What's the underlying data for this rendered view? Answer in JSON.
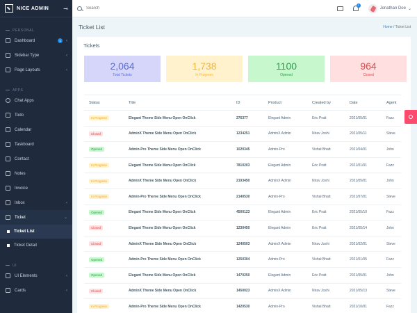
{
  "brand": {
    "name": "NICE ADMIN"
  },
  "sidebar": {
    "section_personal": "PERSONAL",
    "section_apps": "APPS",
    "section_ui": "UI",
    "items": [
      {
        "label": "Dashboard",
        "icon": "home-icon",
        "badge": "1"
      },
      {
        "label": "Sidebar Type",
        "icon": "sidebar-icon"
      },
      {
        "label": "Page Layouts",
        "icon": "layout-icon"
      },
      {
        "label": "Chat Apps",
        "icon": "chat-icon"
      },
      {
        "label": "Todo",
        "icon": "todo-icon"
      },
      {
        "label": "Calendar",
        "icon": "calendar-icon"
      },
      {
        "label": "Taskboard",
        "icon": "taskboard-icon"
      },
      {
        "label": "Contact",
        "icon": "contact-icon"
      },
      {
        "label": "Notes",
        "icon": "notes-icon"
      },
      {
        "label": "Invoice",
        "icon": "invoice-icon"
      },
      {
        "label": "Inbox",
        "icon": "inbox-icon"
      },
      {
        "label": "Ticket",
        "icon": "ticket-icon"
      },
      {
        "label": "Ticket List"
      },
      {
        "label": "Ticket Detail"
      },
      {
        "label": "UI Elements",
        "icon": "ui-icon"
      },
      {
        "label": "Cards",
        "icon": "cards-icon"
      }
    ]
  },
  "topbar": {
    "search_placeholder": "Search",
    "bell_badge": "1",
    "user_name": "Jonathan Doe"
  },
  "page": {
    "title": "Ticket List",
    "breadcrumb_home": "Home",
    "breadcrumb_sep": " / ",
    "breadcrumb_current": "Ticket List"
  },
  "card": {
    "title": "Tickets",
    "stats": [
      {
        "value": "2,064",
        "label": "Total Tickets"
      },
      {
        "value": "1,738",
        "label": "In Progress"
      },
      {
        "value": "1100",
        "label": "Opened"
      },
      {
        "value": "964",
        "label": "Closed"
      }
    ]
  },
  "table": {
    "headers": [
      "Status",
      "Title",
      "ID",
      "Product",
      "Created by",
      "Date",
      "Agent"
    ],
    "rows": [
      {
        "status": "In Progress",
        "kind": "progress",
        "title": "Elegant Theme Side Menu Open OnClick",
        "id": "276377",
        "product": "Elegant Admin",
        "created_by": "Eric Pratt",
        "date": "2021/05/01",
        "agent": "Fazz"
      },
      {
        "status": "Closed",
        "kind": "closed",
        "title": "AdminX Theme Side Menu Open OnClick",
        "id": "1234251",
        "product": "AdminX Admin",
        "created_by": "Nirav Joshi",
        "date": "2021/05/11",
        "agent": "Steve"
      },
      {
        "status": "Opened",
        "kind": "opened",
        "title": "Admin-Pro Theme Side Menu Open OnClick",
        "id": "1020345",
        "product": "Admin-Pro",
        "created_by": "Vishal Bhatt",
        "date": "2021/04/01",
        "agent": "John"
      },
      {
        "status": "In Progress",
        "kind": "progress",
        "title": "Elegant Theme Side Menu Open OnClick",
        "id": "7810203",
        "product": "Elegant Admin",
        "created_by": "Eric Pratt",
        "date": "2021/01/01",
        "agent": "Fazz"
      },
      {
        "status": "In Progress",
        "kind": "progress",
        "title": "AdminX Theme Side Menu Open OnClick",
        "id": "2103450",
        "product": "AdminX Admin",
        "created_by": "Nirav Joshi",
        "date": "2021/05/01",
        "agent": "John"
      },
      {
        "status": "In Progress",
        "kind": "progress",
        "title": "Admin-Pro Theme Side Menu Open OnClick",
        "id": "2140530",
        "product": "Admin-Pro",
        "created_by": "Vishal Bhatt",
        "date": "2021/07/01",
        "agent": "Steve"
      },
      {
        "status": "Opened",
        "kind": "opened",
        "title": "Elegant Theme Side Menu Open OnClick",
        "id": "4500123",
        "product": "Elegant Admin",
        "created_by": "Eric Pratt",
        "date": "2021/05/10",
        "agent": "Fazz"
      },
      {
        "status": "Closed",
        "kind": "closed",
        "title": "Elegant Theme Side Menu Open OnClick",
        "id": "1230450",
        "product": "Elegant Admin",
        "created_by": "Eric Pratt",
        "date": "2021/05/14",
        "agent": "John"
      },
      {
        "status": "Closed",
        "kind": "closed",
        "title": "AdminX Theme Side Menu Open OnClick",
        "id": "1240503",
        "product": "AdminX Admin",
        "created_by": "Nirav Joshi",
        "date": "2021/02/01",
        "agent": "Steve"
      },
      {
        "status": "Opened",
        "kind": "opened",
        "title": "Admin-Pro Theme Side Menu Open OnClick",
        "id": "1250304",
        "product": "Admin-Pro",
        "created_by": "Vishal Bhatt",
        "date": "2021/01/05",
        "agent": "Fazz"
      },
      {
        "status": "Opened",
        "kind": "opened",
        "title": "Elegant Theme Side Menu Open OnClick",
        "id": "1470250",
        "product": "Elegant Admin",
        "created_by": "Eric Pratt",
        "date": "2021/05/01",
        "agent": "John"
      },
      {
        "status": "Closed",
        "kind": "closed",
        "title": "AdminX Theme Side Menu Open OnClick",
        "id": "1450023",
        "product": "AdminX Admin",
        "created_by": "Nirav Joshi",
        "date": "2021/05/13",
        "agent": "Steve"
      },
      {
        "status": "In Progress",
        "kind": "progress",
        "title": "Admin-Pro Theme Side Menu Open OnClick",
        "id": "1420530",
        "product": "Admin-Pro",
        "created_by": "Vishal Bhatt",
        "date": "2021/10/01",
        "agent": "Fazz"
      }
    ]
  },
  "colors": {
    "sidebar_bg": "#1f2a3d",
    "accent": "#1e88e5",
    "settings_tab": "#fc4b6c"
  }
}
